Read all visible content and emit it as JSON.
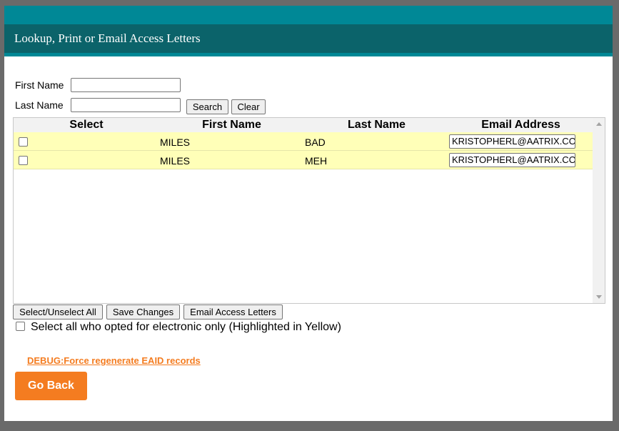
{
  "header": {
    "title": "Lookup, Print or Email Access Letters"
  },
  "search": {
    "first_name_label": "First Name",
    "last_name_label": "Last Name",
    "first_name_value": "",
    "last_name_value": "",
    "search_label": "Search",
    "clear_label": "Clear"
  },
  "grid": {
    "columns": [
      "Select",
      "First Name",
      "Last Name",
      "Email Address"
    ],
    "rows": [
      {
        "first_name": "MILES",
        "last_name": "BAD",
        "email": "KRISTOPHERL@AATRIX.COM",
        "checked": false,
        "highlight": "#ffffb8"
      },
      {
        "first_name": "MILES",
        "last_name": "MEH",
        "email": "KRISTOPHERL@AATRIX.COM",
        "checked": false,
        "highlight": "#ffffb8"
      }
    ]
  },
  "actions": {
    "select_all_label": "Select/Unselect All",
    "save_label": "Save Changes",
    "email_letters_label": "Email Access Letters",
    "electronic_only_label": "Select all who opted for electronic only (Highlighted in Yellow)"
  },
  "footer": {
    "debug_link": "DEBUG:Force regenerate EAID records",
    "go_back_label": "Go Back"
  },
  "colors": {
    "accent": "#f47c20",
    "header_dark": "#0b636a",
    "header_light": "#008896",
    "row_highlight": "#ffffb8"
  }
}
